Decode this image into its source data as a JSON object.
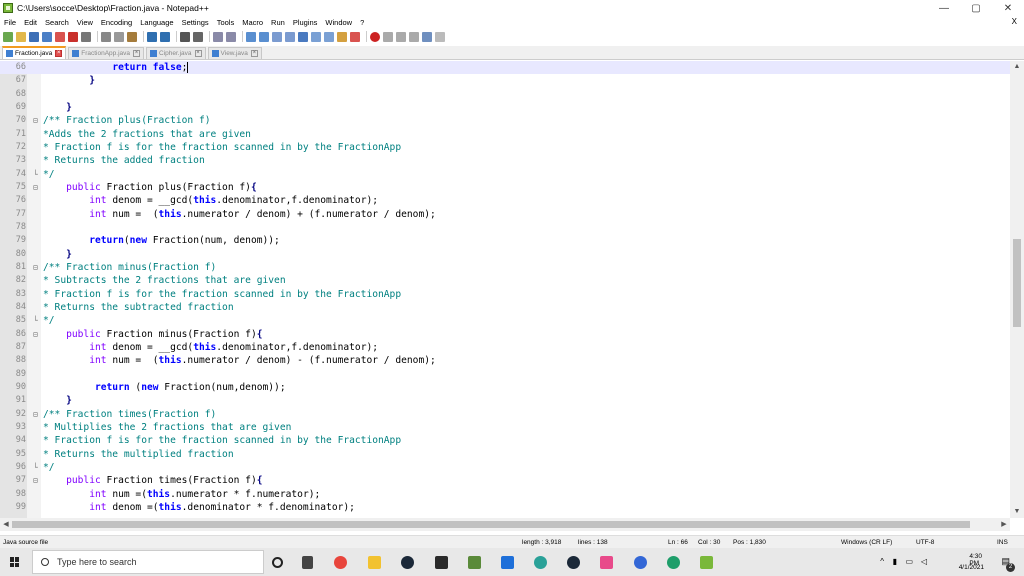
{
  "window": {
    "title": "C:\\Users\\socce\\Desktop\\Fraction.java - Notepad++",
    "minimize": "—",
    "maximize": "▢",
    "close": "✕"
  },
  "menu": [
    "File",
    "Edit",
    "Search",
    "View",
    "Encoding",
    "Language",
    "Settings",
    "Tools",
    "Macro",
    "Run",
    "Plugins",
    "Window",
    "?"
  ],
  "menu_close": "X",
  "tabs": [
    {
      "label": "Fraction.java",
      "active": true
    },
    {
      "label": "FractionApp.java",
      "active": false
    },
    {
      "label": "Cipher.java",
      "active": false
    },
    {
      "label": "View.java",
      "active": false
    }
  ],
  "editor": {
    "current_line": 66,
    "lines": [
      {
        "n": "66",
        "fold": "",
        "html": "            <span class=\"kw\">return</span> <span class=\"kw\">false</span>;<span class=\"caret\"></span>"
      },
      {
        "n": "67",
        "fold": "",
        "html": "        <span class=\"op\">}</span>"
      },
      {
        "n": "68",
        "fold": "",
        "html": ""
      },
      {
        "n": "69",
        "fold": "",
        "html": "    <span class=\"op\">}</span>"
      },
      {
        "n": "70",
        "fold": "⊟",
        "html": "<span class=\"cm\">/** Fraction plus(Fraction f)</span>"
      },
      {
        "n": "71",
        "fold": "",
        "html": "<span class=\"cm\">*Adds the 2 fractions that are given</span>"
      },
      {
        "n": "72",
        "fold": "",
        "html": "<span class=\"cm\">* Fraction f is for the fraction scanned in by the FractionApp</span>"
      },
      {
        "n": "73",
        "fold": "",
        "html": "<span class=\"cm\">* Returns the added fraction</span>"
      },
      {
        "n": "74",
        "fold": "└",
        "html": "<span class=\"cm\">*/</span>"
      },
      {
        "n": "75",
        "fold": "⊟",
        "html": "    <span class=\"ty\">public</span> Fraction plus(Fraction f)<span class=\"op\">{</span>"
      },
      {
        "n": "76",
        "fold": "",
        "html": "        <span class=\"ty\">int</span> denom = __gcd(<span class=\"kw\">this</span>.denominator,f.denominator);"
      },
      {
        "n": "77",
        "fold": "",
        "html": "        <span class=\"ty\">int</span> num =  (<span class=\"kw\">this</span>.numerator / denom) + (f.numerator / denom);"
      },
      {
        "n": "78",
        "fold": "",
        "html": ""
      },
      {
        "n": "79",
        "fold": "",
        "html": "        <span class=\"kw\">return</span>(<span class=\"kw\">new</span> Fraction(num, denom));"
      },
      {
        "n": "80",
        "fold": "",
        "html": "    <span class=\"op\">}</span>"
      },
      {
        "n": "81",
        "fold": "⊟",
        "html": "<span class=\"cm\">/** Fraction minus(Fraction f)</span>"
      },
      {
        "n": "82",
        "fold": "",
        "html": "<span class=\"cm\">* Subtracts the 2 fractions that are given</span>"
      },
      {
        "n": "83",
        "fold": "",
        "html": "<span class=\"cm\">* Fraction f is for the fraction scanned in by the FractionApp</span>"
      },
      {
        "n": "84",
        "fold": "",
        "html": "<span class=\"cm\">* Returns the subtracted fraction</span>"
      },
      {
        "n": "85",
        "fold": "└",
        "html": "<span class=\"cm\">*/</span>"
      },
      {
        "n": "86",
        "fold": "⊟",
        "html": "    <span class=\"ty\">public</span> Fraction minus(Fraction f)<span class=\"op\">{</span>"
      },
      {
        "n": "87",
        "fold": "",
        "html": "        <span class=\"ty\">int</span> denom = __gcd(<span class=\"kw\">this</span>.denominator,f.denominator);"
      },
      {
        "n": "88",
        "fold": "",
        "html": "        <span class=\"ty\">int</span> num =  (<span class=\"kw\">this</span>.numerator / denom) - (f.numerator / denom);"
      },
      {
        "n": "89",
        "fold": "",
        "html": ""
      },
      {
        "n": "90",
        "fold": "",
        "html": "         <span class=\"kw\">return</span> (<span class=\"kw\">new</span> Fraction(num,denom));"
      },
      {
        "n": "91",
        "fold": "",
        "html": "    <span class=\"op\">}</span>"
      },
      {
        "n": "92",
        "fold": "⊟",
        "html": "<span class=\"cm\">/** Fraction times(Fraction f)</span>"
      },
      {
        "n": "93",
        "fold": "",
        "html": "<span class=\"cm\">* Multiplies the 2 fractions that are given</span>"
      },
      {
        "n": "94",
        "fold": "",
        "html": "<span class=\"cm\">* Fraction f is for the fraction scanned in by the FractionApp</span>"
      },
      {
        "n": "95",
        "fold": "",
        "html": "<span class=\"cm\">* Returns the multiplied fraction</span>"
      },
      {
        "n": "96",
        "fold": "└",
        "html": "<span class=\"cm\">*/</span>"
      },
      {
        "n": "97",
        "fold": "⊟",
        "html": "    <span class=\"ty\">public</span> Fraction times(Fraction f)<span class=\"op\">{</span>"
      },
      {
        "n": "98",
        "fold": "",
        "html": "        <span class=\"ty\">int</span> num =(<span class=\"kw\">this</span>.numerator * f.numerator);"
      },
      {
        "n": "99",
        "fold": "",
        "html": "        <span class=\"ty\">int</span> denom =(<span class=\"kw\">this</span>.denominator * f.denominator);"
      }
    ]
  },
  "status": {
    "file_type": "Java source file",
    "length": "length : 3,918",
    "lines": "lines : 138",
    "ln": "Ln : 66",
    "col": "Col : 30",
    "pos": "Pos : 1,830",
    "eol": "Windows (CR LF)",
    "encoding": "UTF-8",
    "mode": "INS"
  },
  "taskbar": {
    "search_placeholder": "Type here to search",
    "time": "4:30 PM",
    "date": "4/1/2021",
    "notifications": "2"
  }
}
